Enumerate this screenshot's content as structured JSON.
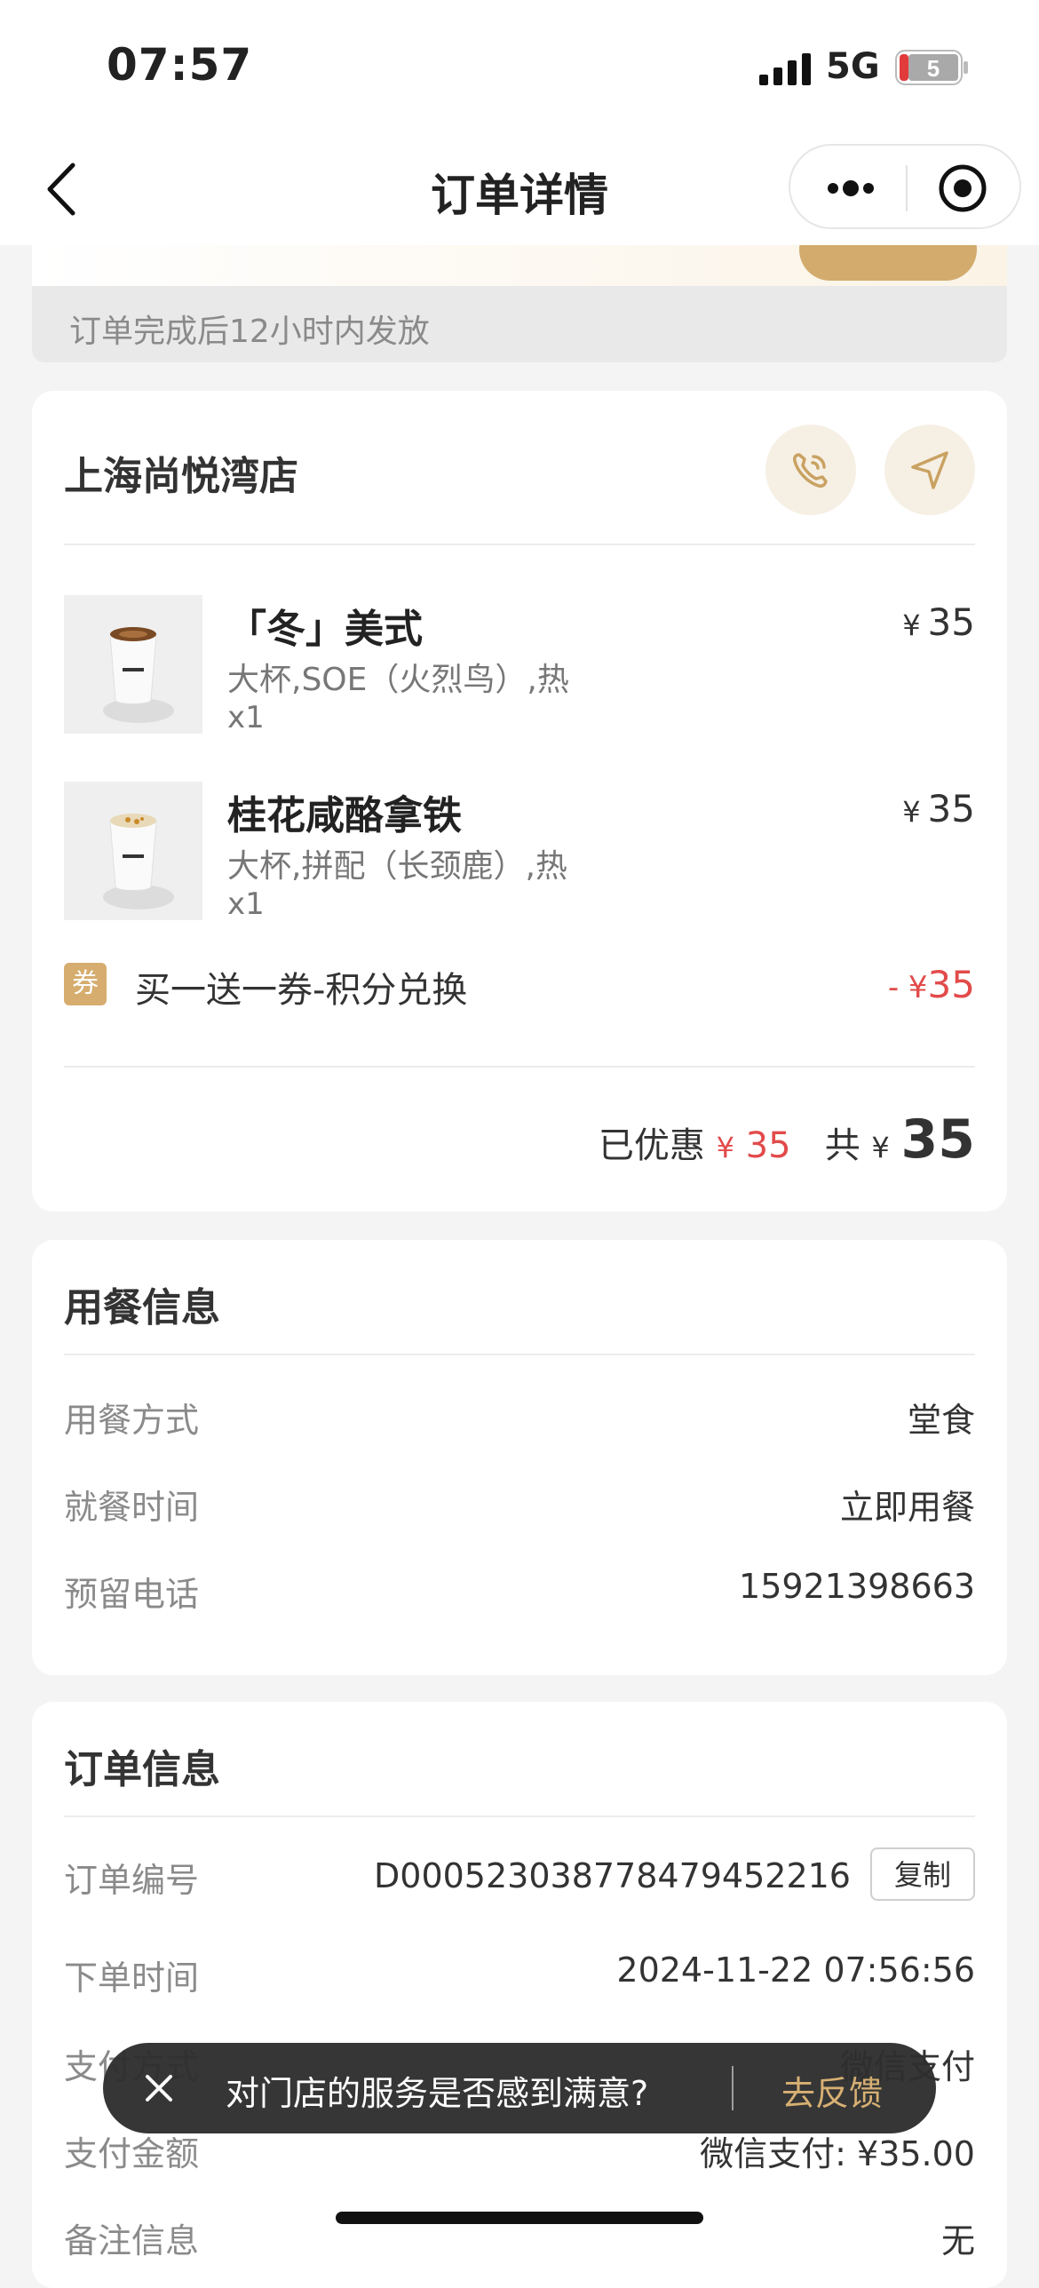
{
  "status_bar": {
    "time": "07:57",
    "network": "5G",
    "battery": "5"
  },
  "nav": {
    "title": "订单详情"
  },
  "notice": "订单完成后12小时内发放",
  "store": {
    "name": "上海尚悦湾店",
    "items": [
      {
        "name": "「冬」美式",
        "spec": "大杯,SOE（火烈鸟）,热",
        "qty": "x1",
        "currency": "¥",
        "price": "35"
      },
      {
        "name": "桂花咸酪拿铁",
        "spec": "大杯,拼配（长颈鹿）,热",
        "qty": "x1",
        "currency": "¥",
        "price": "35"
      }
    ],
    "coupon": {
      "tag": "券",
      "label": "买一送一券-积分兑换",
      "amount_prefix": "- ¥",
      "amount": "35"
    },
    "totals": {
      "discount_label": "已优惠",
      "discount_currency": "¥",
      "discount": "35",
      "total_label": "共",
      "total_currency": "¥",
      "total": "35"
    }
  },
  "dining": {
    "title": "用餐信息",
    "rows": [
      {
        "key": "用餐方式",
        "value": "堂食"
      },
      {
        "key": "就餐时间",
        "value": "立即用餐"
      },
      {
        "key": "预留电话",
        "value": "15921398663"
      }
    ]
  },
  "order": {
    "title": "订单信息",
    "rows": [
      {
        "key": "订单编号",
        "value": "D000523038778479452216"
      },
      {
        "key": "下单时间",
        "value": "2024-11-22 07:56:56"
      },
      {
        "key": "支付方式",
        "value": "微信支付"
      },
      {
        "key": "支付金额",
        "value": "微信支付: ¥35.00"
      },
      {
        "key": "备注信息",
        "value": "无"
      }
    ],
    "copy_label": "复制"
  },
  "toast": {
    "message": "对门店的服务是否感到满意?",
    "action": "去反馈"
  },
  "colors": {
    "accent_gold": "#d6ad6e",
    "price_red": "#e24a4a"
  }
}
